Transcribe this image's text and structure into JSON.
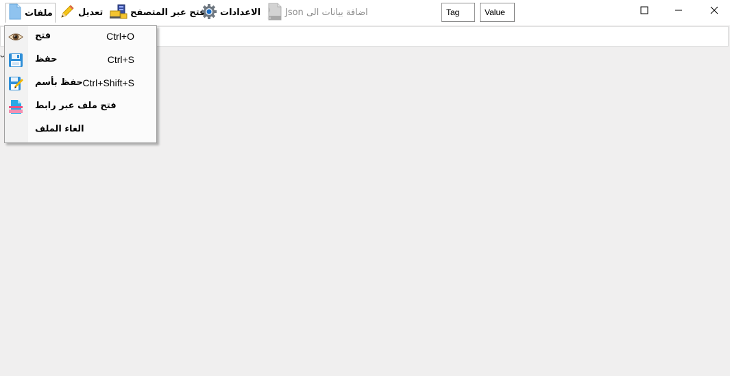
{
  "toolbar": {
    "files_label": "ملفات",
    "edit_label": "تعديل",
    "open_browser_label": "فتح عبر المتصفح",
    "settings_label": "الاعدادات",
    "add_json_label": "اضافة بيانات الى Json",
    "tag_value": "Tag",
    "value_value": "Value"
  },
  "window": {
    "minimize_icon": "minimize-icon",
    "maximize_icon": "maximize-icon",
    "close_icon": "close-icon"
  },
  "strip": {
    "glyph": "ل"
  },
  "file_menu": {
    "items": [
      {
        "label": "فتح",
        "shortcut": "Ctrl+O",
        "icon": "eye-icon"
      },
      {
        "label": "حفظ",
        "shortcut": "Ctrl+S",
        "icon": "save-icon"
      },
      {
        "label": "حفظ بأسم",
        "shortcut": "Ctrl+Shift+S",
        "icon": "save-as-icon"
      },
      {
        "label": "فتح ملف عبر رابط",
        "shortcut": "",
        "icon": "link-file-icon"
      },
      {
        "label": "الغاء الملف",
        "shortcut": "",
        "icon": ""
      }
    ]
  },
  "colors": {
    "background": "#f0efef",
    "disabled_text": "#8c8c8c"
  }
}
